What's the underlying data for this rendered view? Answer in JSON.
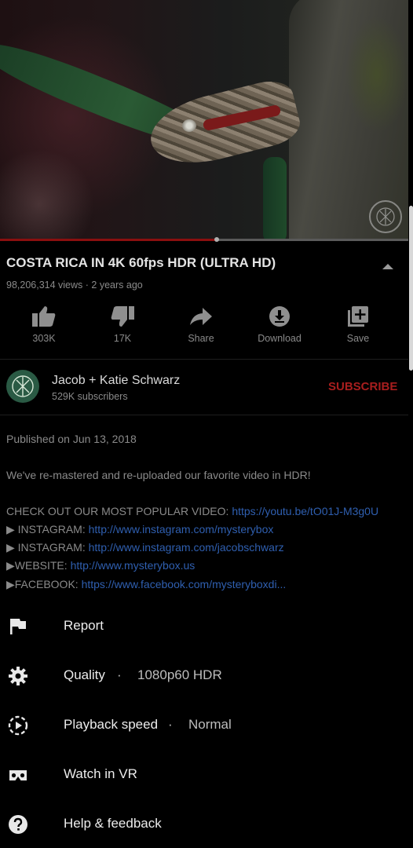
{
  "video": {
    "title": "COSTA RICA IN 4K 60fps HDR (ULTRA HD)",
    "meta": "98,206,314 views · 2 years ago",
    "progress_fraction": 0.53
  },
  "actions": [
    {
      "label": "303K",
      "icon": "thumbs-up-icon"
    },
    {
      "label": "17K",
      "icon": "thumbs-down-icon"
    },
    {
      "label": "Share",
      "icon": "share-icon"
    },
    {
      "label": "Download",
      "icon": "download-icon"
    },
    {
      "label": "Save",
      "icon": "add-to-playlist-icon"
    }
  ],
  "channel": {
    "name": "Jacob + Katie Schwarz",
    "subscribers": "529K subscribers",
    "subscribe_label": "SUBSCRIBE"
  },
  "description": {
    "published": "Published on Jun 13, 2018",
    "intro": "We've re-mastered and re-uploaded our favorite video in HDR!",
    "lines": [
      {
        "prefix": "CHECK OUT OUR MOST POPULAR VIDEO: ",
        "link": "https://youtu.be/tO01J-M3g0U"
      },
      {
        "prefix": "▶ INSTAGRAM: ",
        "link": "http://www.instagram.com/mysterybox"
      },
      {
        "prefix": "▶ INSTAGRAM: ",
        "link": "http://www.instagram.com/jacobschwarz"
      },
      {
        "prefix": "▶WEBSITE: ",
        "link": "http://www.mysterybox.us"
      },
      {
        "prefix": "▶FACEBOOK: ",
        "link": "https://www.facebook.com/mysteryboxdi..."
      }
    ]
  },
  "menu": [
    {
      "label": "Report",
      "icon": "flag-icon"
    },
    {
      "label": "Quality",
      "dot": "·",
      "value": "1080p60 HDR",
      "icon": "gear-icon"
    },
    {
      "label": "Playback speed",
      "dot": "·",
      "value": "Normal",
      "icon": "playback-speed-icon"
    },
    {
      "label": "Watch in VR",
      "icon": "vr-headset-icon"
    },
    {
      "label": "Help & feedback",
      "icon": "help-icon"
    }
  ],
  "colors": {
    "background": "#000000",
    "subscribe": "#a81e1e",
    "link": "#2f5fb0",
    "progress": "#8b0f0f"
  }
}
